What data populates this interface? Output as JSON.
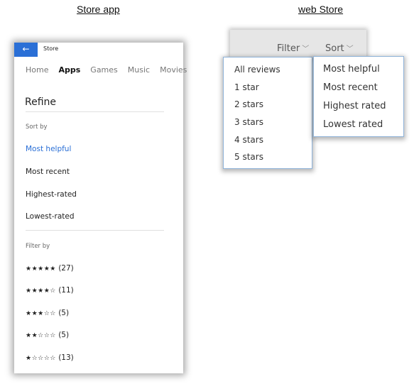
{
  "captions": {
    "store_app": "Store app",
    "web_store": "web Store"
  },
  "store_app": {
    "title": "Store",
    "back_icon": "←",
    "nav": [
      {
        "label": "Home",
        "active": false
      },
      {
        "label": "Apps",
        "active": true
      },
      {
        "label": "Games",
        "active": false
      },
      {
        "label": "Music",
        "active": false
      },
      {
        "label": "Movies",
        "active": false
      }
    ],
    "refine_title": "Refine",
    "sort_label": "Sort by",
    "sort_options": [
      {
        "label": "Most helpful",
        "selected": true
      },
      {
        "label": "Most recent",
        "selected": false
      },
      {
        "label": "Highest-rated",
        "selected": false
      },
      {
        "label": "Lowest-rated",
        "selected": false
      }
    ],
    "filter_label": "Filter by",
    "filter_options": [
      {
        "stars": "★★★★★",
        "rating": 5,
        "count": "(27)"
      },
      {
        "stars": "★★★★☆",
        "rating": 4,
        "count": "(11)"
      },
      {
        "stars": "★★★☆☆",
        "rating": 3,
        "count": "(5)"
      },
      {
        "stars": "★★☆☆☆",
        "rating": 2,
        "count": "(5)"
      },
      {
        "stars": "★☆☆☆☆",
        "rating": 1,
        "count": "(13)"
      }
    ],
    "accent_color": "#2a6fd6"
  },
  "web_store": {
    "filter_button": "Filter",
    "sort_button": "Sort",
    "chevron": "﹀",
    "filter_menu": [
      "All reviews",
      "1 star",
      "2 stars",
      "3 stars",
      "4 stars",
      "5 stars"
    ],
    "sort_menu": [
      "Most helpful",
      "Most recent",
      "Highest rated",
      "Lowest rated"
    ]
  }
}
